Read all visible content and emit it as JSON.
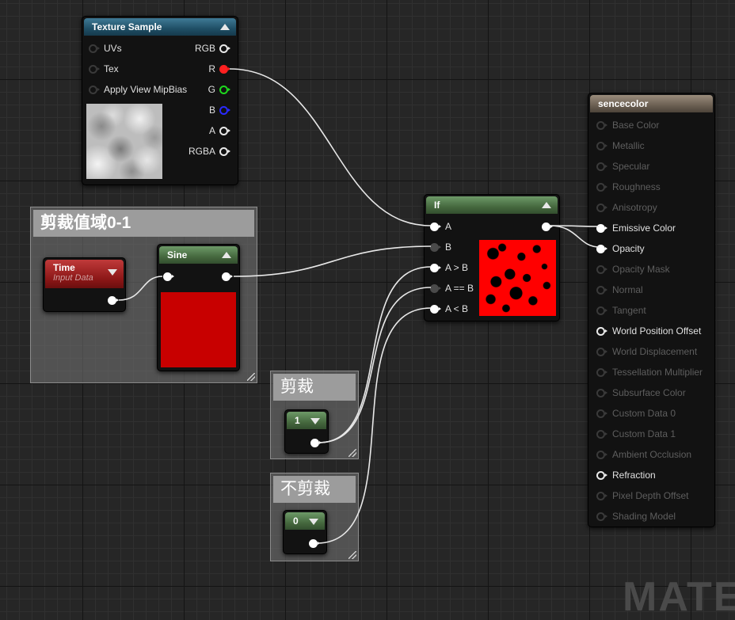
{
  "texture_sample": {
    "title": "Texture Sample",
    "inputs": [
      "UVs",
      "Tex",
      "Apply View MipBias"
    ],
    "outputs": [
      "RGB",
      "R",
      "G",
      "B",
      "A",
      "RGBA"
    ]
  },
  "comment_clamp": {
    "title": "剪裁值域0-1"
  },
  "time_node": {
    "title": "Time",
    "subtitle": "Input Data"
  },
  "sine_node": {
    "title": "Sine"
  },
  "if_node": {
    "title": "If",
    "inputs": [
      "A",
      "B",
      "A > B",
      "A == B",
      "A < B"
    ]
  },
  "comment_clip": {
    "title": "剪裁"
  },
  "comment_noclip": {
    "title": "不剪裁"
  },
  "const_one": {
    "value": "1"
  },
  "const_zero": {
    "value": "0"
  },
  "material_node": {
    "title": "sencecolor",
    "inputs": [
      "Base Color",
      "Metallic",
      "Specular",
      "Roughness",
      "Anisotropy",
      "Emissive Color",
      "Opacity",
      "Opacity Mask",
      "Normal",
      "Tangent",
      "World Position Offset",
      "World Displacement",
      "Tessellation Multiplier",
      "Subsurface Color",
      "Custom Data 0",
      "Custom Data 1",
      "Ambient Occlusion",
      "Refraction",
      "Pixel Depth Offset",
      "Shading Model"
    ]
  },
  "watermark": "MATE",
  "colors": {
    "pin_red": "#ff2020",
    "pin_green": "#1ed81e",
    "pin_blue": "#2a2aff",
    "sine_preview": "#c80000",
    "wire": "#e8e8e8"
  }
}
